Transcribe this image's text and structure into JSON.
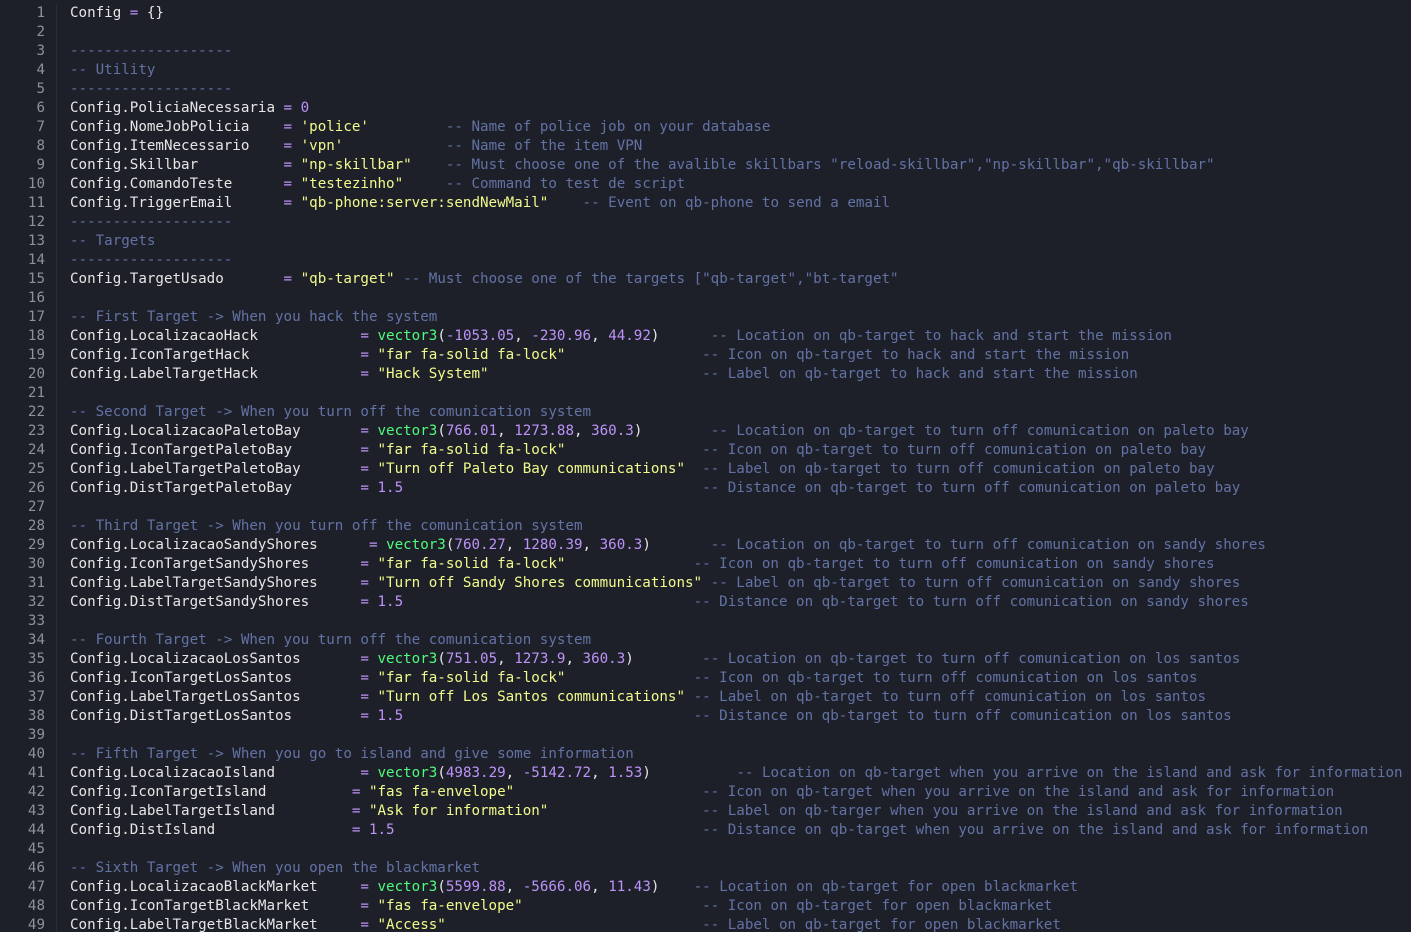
{
  "editor": {
    "language": "lua",
    "colors": {
      "background": "#1e2029",
      "gutter_text": "#8e919c",
      "plain": "#e6e6e6",
      "operator": "#bd93f9",
      "number": "#bd93f9",
      "string": "#f1fa8c",
      "function": "#50fa7b",
      "comment": "#6272a4"
    },
    "lines": [
      [
        {
          "t": "Config ",
          "c": "plain"
        },
        {
          "t": "=",
          "c": "op"
        },
        {
          "t": " {}",
          "c": "plain"
        }
      ],
      [],
      [
        {
          "t": "-------------------",
          "c": "comment"
        }
      ],
      [
        {
          "t": "-- Utility",
          "c": "comment"
        }
      ],
      [
        {
          "t": "-------------------",
          "c": "comment"
        }
      ],
      [
        {
          "t": "Config.PoliciaNecessaria ",
          "c": "plain"
        },
        {
          "t": "=",
          "c": "op"
        },
        {
          "t": " ",
          "c": "plain"
        },
        {
          "t": "0",
          "c": "num"
        }
      ],
      [
        {
          "t": "Config.NomeJobPolicia    ",
          "c": "plain"
        },
        {
          "t": "=",
          "c": "op"
        },
        {
          "t": " ",
          "c": "plain"
        },
        {
          "t": "'police'",
          "c": "str"
        },
        {
          "t": "         ",
          "c": "plain"
        },
        {
          "t": "-- Name of police job on your database",
          "c": "comment"
        }
      ],
      [
        {
          "t": "Config.ItemNecessario    ",
          "c": "plain"
        },
        {
          "t": "=",
          "c": "op"
        },
        {
          "t": " ",
          "c": "plain"
        },
        {
          "t": "'vpn'",
          "c": "str"
        },
        {
          "t": "            ",
          "c": "plain"
        },
        {
          "t": "-- Name of the item VPN",
          "c": "comment"
        }
      ],
      [
        {
          "t": "Config.Skillbar          ",
          "c": "plain"
        },
        {
          "t": "=",
          "c": "op"
        },
        {
          "t": " ",
          "c": "plain"
        },
        {
          "t": "\"np-skillbar\"",
          "c": "str"
        },
        {
          "t": "    ",
          "c": "plain"
        },
        {
          "t": "-- Must choose one of the avalible skillbars \"reload-skillbar\",\"np-skillbar\",\"qb-skillbar\"",
          "c": "comment"
        }
      ],
      [
        {
          "t": "Config.ComandoTeste      ",
          "c": "plain"
        },
        {
          "t": "=",
          "c": "op"
        },
        {
          "t": " ",
          "c": "plain"
        },
        {
          "t": "\"testezinho\"",
          "c": "str"
        },
        {
          "t": "     ",
          "c": "plain"
        },
        {
          "t": "-- Command to test de script",
          "c": "comment"
        }
      ],
      [
        {
          "t": "Config.TriggerEmail      ",
          "c": "plain"
        },
        {
          "t": "=",
          "c": "op"
        },
        {
          "t": " ",
          "c": "plain"
        },
        {
          "t": "\"qb-phone:server:sendNewMail\"",
          "c": "str"
        },
        {
          "t": "    ",
          "c": "plain"
        },
        {
          "t": "-- Event on qb-phone to send a email",
          "c": "comment"
        }
      ],
      [
        {
          "t": "-------------------",
          "c": "comment"
        }
      ],
      [
        {
          "t": "-- Targets",
          "c": "comment"
        }
      ],
      [
        {
          "t": "-------------------",
          "c": "comment"
        }
      ],
      [
        {
          "t": "Config.TargetUsado       ",
          "c": "plain"
        },
        {
          "t": "=",
          "c": "op"
        },
        {
          "t": " ",
          "c": "plain"
        },
        {
          "t": "\"qb-target\"",
          "c": "str"
        },
        {
          "t": " ",
          "c": "plain"
        },
        {
          "t": "-- Must choose one of the targets [\"qb-target\",\"bt-target\"",
          "c": "comment"
        }
      ],
      [],
      [
        {
          "t": "-- First Target -> When you hack the system",
          "c": "comment"
        }
      ],
      [
        {
          "t": "Config.LocalizacaoHack            ",
          "c": "plain"
        },
        {
          "t": "=",
          "c": "op"
        },
        {
          "t": " ",
          "c": "plain"
        },
        {
          "t": "vector3",
          "c": "fn"
        },
        {
          "t": "(",
          "c": "plain"
        },
        {
          "t": "-1053.05",
          "c": "num"
        },
        {
          "t": ", ",
          "c": "plain"
        },
        {
          "t": "-230.96",
          "c": "num"
        },
        {
          "t": ", ",
          "c": "plain"
        },
        {
          "t": "44.92",
          "c": "num"
        },
        {
          "t": ")",
          "c": "plain"
        },
        {
          "t": "      ",
          "c": "plain"
        },
        {
          "t": "-- Location on qb-target to hack and start the mission",
          "c": "comment"
        }
      ],
      [
        {
          "t": "Config.IconTargetHack             ",
          "c": "plain"
        },
        {
          "t": "=",
          "c": "op"
        },
        {
          "t": " ",
          "c": "plain"
        },
        {
          "t": "\"far fa-solid fa-lock\"",
          "c": "str"
        },
        {
          "t": "                ",
          "c": "plain"
        },
        {
          "t": "-- Icon on qb-target to hack and start the mission",
          "c": "comment"
        }
      ],
      [
        {
          "t": "Config.LabelTargetHack            ",
          "c": "plain"
        },
        {
          "t": "=",
          "c": "op"
        },
        {
          "t": " ",
          "c": "plain"
        },
        {
          "t": "\"Hack System\"",
          "c": "str"
        },
        {
          "t": "                         ",
          "c": "plain"
        },
        {
          "t": "-- Label on qb-target to hack and start the mission",
          "c": "comment"
        }
      ],
      [],
      [
        {
          "t": "-- Second Target -> When you turn off the comunication system",
          "c": "comment"
        }
      ],
      [
        {
          "t": "Config.LocalizacaoPaletoBay       ",
          "c": "plain"
        },
        {
          "t": "=",
          "c": "op"
        },
        {
          "t": " ",
          "c": "plain"
        },
        {
          "t": "vector3",
          "c": "fn"
        },
        {
          "t": "(",
          "c": "plain"
        },
        {
          "t": "766.01",
          "c": "num"
        },
        {
          "t": ", ",
          "c": "plain"
        },
        {
          "t": "1273.88",
          "c": "num"
        },
        {
          "t": ", ",
          "c": "plain"
        },
        {
          "t": "360.3",
          "c": "num"
        },
        {
          "t": ")",
          "c": "plain"
        },
        {
          "t": "        ",
          "c": "plain"
        },
        {
          "t": "-- Location on qb-target to turn off comunication on paleto bay",
          "c": "comment"
        }
      ],
      [
        {
          "t": "Config.IconTargetPaletoBay        ",
          "c": "plain"
        },
        {
          "t": "=",
          "c": "op"
        },
        {
          "t": " ",
          "c": "plain"
        },
        {
          "t": "\"far fa-solid fa-lock\"",
          "c": "str"
        },
        {
          "t": "                ",
          "c": "plain"
        },
        {
          "t": "-- Icon on qb-target to turn off comunication on paleto bay",
          "c": "comment"
        }
      ],
      [
        {
          "t": "Config.LabelTargetPaletoBay       ",
          "c": "plain"
        },
        {
          "t": "=",
          "c": "op"
        },
        {
          "t": " ",
          "c": "plain"
        },
        {
          "t": "\"Turn off Paleto Bay communications\"",
          "c": "str"
        },
        {
          "t": "  ",
          "c": "plain"
        },
        {
          "t": "-- Label on qb-target to turn off comunication on paleto bay",
          "c": "comment"
        }
      ],
      [
        {
          "t": "Config.DistTargetPaletoBay        ",
          "c": "plain"
        },
        {
          "t": "=",
          "c": "op"
        },
        {
          "t": " ",
          "c": "plain"
        },
        {
          "t": "1.5",
          "c": "num"
        },
        {
          "t": "                                   ",
          "c": "plain"
        },
        {
          "t": "-- Distance on qb-target to turn off comunication on paleto bay",
          "c": "comment"
        }
      ],
      [],
      [
        {
          "t": "-- Third Target -> When you turn off the comunication system",
          "c": "comment"
        }
      ],
      [
        {
          "t": "Config.LocalizacaoSandyShores      ",
          "c": "plain"
        },
        {
          "t": "=",
          "c": "op"
        },
        {
          "t": " ",
          "c": "plain"
        },
        {
          "t": "vector3",
          "c": "fn"
        },
        {
          "t": "(",
          "c": "plain"
        },
        {
          "t": "760.27",
          "c": "num"
        },
        {
          "t": ", ",
          "c": "plain"
        },
        {
          "t": "1280.39",
          "c": "num"
        },
        {
          "t": ", ",
          "c": "plain"
        },
        {
          "t": "360.3",
          "c": "num"
        },
        {
          "t": ")",
          "c": "plain"
        },
        {
          "t": "       ",
          "c": "plain"
        },
        {
          "t": "-- Location on qb-target to turn off comunication on sandy shores",
          "c": "comment"
        }
      ],
      [
        {
          "t": "Config.IconTargetSandyShores      ",
          "c": "plain"
        },
        {
          "t": "=",
          "c": "op"
        },
        {
          "t": " ",
          "c": "plain"
        },
        {
          "t": "\"far fa-solid fa-lock\"",
          "c": "str"
        },
        {
          "t": "               ",
          "c": "plain"
        },
        {
          "t": "-- Icon on qb-target to turn off comunication on sandy shores",
          "c": "comment"
        }
      ],
      [
        {
          "t": "Config.LabelTargetSandyShores     ",
          "c": "plain"
        },
        {
          "t": "=",
          "c": "op"
        },
        {
          "t": " ",
          "c": "plain"
        },
        {
          "t": "\"Turn off Sandy Shores communications\"",
          "c": "str"
        },
        {
          "t": " ",
          "c": "plain"
        },
        {
          "t": "-- Label on qb-target to turn off comunication on sandy shores",
          "c": "comment"
        }
      ],
      [
        {
          "t": "Config.DistTargetSandyShores      ",
          "c": "plain"
        },
        {
          "t": "=",
          "c": "op"
        },
        {
          "t": " ",
          "c": "plain"
        },
        {
          "t": "1.5",
          "c": "num"
        },
        {
          "t": "                                  ",
          "c": "plain"
        },
        {
          "t": "-- Distance on qb-target to turn off comunication on sandy shores",
          "c": "comment"
        }
      ],
      [],
      [
        {
          "t": "-- Fourth Target -> When you turn off the comunication system",
          "c": "comment"
        }
      ],
      [
        {
          "t": "Config.LocalizacaoLosSantos       ",
          "c": "plain"
        },
        {
          "t": "=",
          "c": "op"
        },
        {
          "t": " ",
          "c": "plain"
        },
        {
          "t": "vector3",
          "c": "fn"
        },
        {
          "t": "(",
          "c": "plain"
        },
        {
          "t": "751.05",
          "c": "num"
        },
        {
          "t": ", ",
          "c": "plain"
        },
        {
          "t": "1273.9",
          "c": "num"
        },
        {
          "t": ", ",
          "c": "plain"
        },
        {
          "t": "360.3",
          "c": "num"
        },
        {
          "t": ")",
          "c": "plain"
        },
        {
          "t": "        ",
          "c": "plain"
        },
        {
          "t": "-- Location on qb-target to turn off comunication on los santos",
          "c": "comment"
        }
      ],
      [
        {
          "t": "Config.IconTargetLosSantos        ",
          "c": "plain"
        },
        {
          "t": "=",
          "c": "op"
        },
        {
          "t": " ",
          "c": "plain"
        },
        {
          "t": "\"far fa-solid fa-lock\"",
          "c": "str"
        },
        {
          "t": "               ",
          "c": "plain"
        },
        {
          "t": "-- Icon on qb-target to turn off comunication on los santos",
          "c": "comment"
        }
      ],
      [
        {
          "t": "Config.LabelTargetLosSantos       ",
          "c": "plain"
        },
        {
          "t": "=",
          "c": "op"
        },
        {
          "t": " ",
          "c": "plain"
        },
        {
          "t": "\"Turn off Los Santos communications\"",
          "c": "str"
        },
        {
          "t": " ",
          "c": "plain"
        },
        {
          "t": "-- Label on qb-target to turn off comunication on los santos",
          "c": "comment"
        }
      ],
      [
        {
          "t": "Config.DistTargetLosSantos        ",
          "c": "plain"
        },
        {
          "t": "=",
          "c": "op"
        },
        {
          "t": " ",
          "c": "plain"
        },
        {
          "t": "1.5",
          "c": "num"
        },
        {
          "t": "                                  ",
          "c": "plain"
        },
        {
          "t": "-- Distance on qb-target to turn off comunication on los santos",
          "c": "comment"
        }
      ],
      [],
      [
        {
          "t": "-- Fifth Target -> When you go to island and give some information",
          "c": "comment"
        }
      ],
      [
        {
          "t": "Config.LocalizacaoIsland          ",
          "c": "plain"
        },
        {
          "t": "=",
          "c": "op"
        },
        {
          "t": " ",
          "c": "plain"
        },
        {
          "t": "vector3",
          "c": "fn"
        },
        {
          "t": "(",
          "c": "plain"
        },
        {
          "t": "4983.29",
          "c": "num"
        },
        {
          "t": ", ",
          "c": "plain"
        },
        {
          "t": "-5142.72",
          "c": "num"
        },
        {
          "t": ", ",
          "c": "plain"
        },
        {
          "t": "1.53",
          "c": "num"
        },
        {
          "t": ")",
          "c": "plain"
        },
        {
          "t": "          ",
          "c": "plain"
        },
        {
          "t": "-- Location on qb-target when you arrive on the island and ask for information",
          "c": "comment"
        }
      ],
      [
        {
          "t": "Config.IconTargetIsland          ",
          "c": "plain"
        },
        {
          "t": "=",
          "c": "op"
        },
        {
          "t": " ",
          "c": "plain"
        },
        {
          "t": "\"fas fa-envelope\"",
          "c": "str"
        },
        {
          "t": "                      ",
          "c": "plain"
        },
        {
          "t": "-- Icon on qb-target when you arrive on the island and ask for information",
          "c": "comment"
        }
      ],
      [
        {
          "t": "Config.LabelTargetIsland         ",
          "c": "plain"
        },
        {
          "t": "=",
          "c": "op"
        },
        {
          "t": " ",
          "c": "plain"
        },
        {
          "t": "\"Ask for information\"",
          "c": "str"
        },
        {
          "t": "                  ",
          "c": "plain"
        },
        {
          "t": "-- Label on qb-targer when you arrive on the island and ask for information",
          "c": "comment"
        }
      ],
      [
        {
          "t": "Config.DistIsland                ",
          "c": "plain"
        },
        {
          "t": "=",
          "c": "op"
        },
        {
          "t": " ",
          "c": "plain"
        },
        {
          "t": "1.5",
          "c": "num"
        },
        {
          "t": "                                    ",
          "c": "plain"
        },
        {
          "t": "-- Distance on qb-target when you arrive on the island and ask for information",
          "c": "comment"
        }
      ],
      [],
      [
        {
          "t": "-- Sixth Target -> When you open the blackmarket",
          "c": "comment"
        }
      ],
      [
        {
          "t": "Config.LocalizacaoBlackMarket     ",
          "c": "plain"
        },
        {
          "t": "=",
          "c": "op"
        },
        {
          "t": " ",
          "c": "plain"
        },
        {
          "t": "vector3",
          "c": "fn"
        },
        {
          "t": "(",
          "c": "plain"
        },
        {
          "t": "5599.88",
          "c": "num"
        },
        {
          "t": ", ",
          "c": "plain"
        },
        {
          "t": "-5666.06",
          "c": "num"
        },
        {
          "t": ", ",
          "c": "plain"
        },
        {
          "t": "11.43",
          "c": "num"
        },
        {
          "t": ")",
          "c": "plain"
        },
        {
          "t": "    ",
          "c": "plain"
        },
        {
          "t": "-- Location on qb-target for open blackmarket",
          "c": "comment"
        }
      ],
      [
        {
          "t": "Config.IconTargetBlackMarket      ",
          "c": "plain"
        },
        {
          "t": "=",
          "c": "op"
        },
        {
          "t": " ",
          "c": "plain"
        },
        {
          "t": "\"fas fa-envelope\"",
          "c": "str"
        },
        {
          "t": "                     ",
          "c": "plain"
        },
        {
          "t": "-- Icon on qb-target for open blackmarket",
          "c": "comment"
        }
      ],
      [
        {
          "t": "Config.LabelTargetBlackMarket     ",
          "c": "plain"
        },
        {
          "t": "=",
          "c": "op"
        },
        {
          "t": " ",
          "c": "plain"
        },
        {
          "t": "\"Access\"",
          "c": "str"
        },
        {
          "t": "                              ",
          "c": "plain"
        },
        {
          "t": "-- Label on qb-target for open blackmarket",
          "c": "comment"
        }
      ]
    ]
  }
}
